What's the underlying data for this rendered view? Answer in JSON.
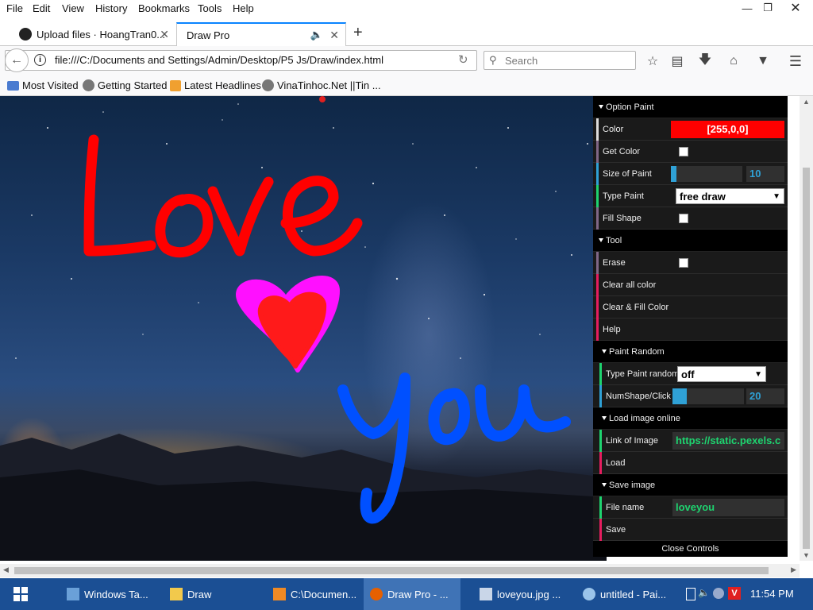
{
  "menubar": {
    "items": [
      "File",
      "Edit",
      "View",
      "History",
      "Bookmarks",
      "Tools",
      "Help"
    ],
    "window_controls": [
      "minimize",
      "maximize",
      "close"
    ]
  },
  "tabs": [
    {
      "label": "Upload files · HoangTran0...",
      "icon": "github-icon",
      "active": false
    },
    {
      "label": "Draw Pro",
      "icon": "audio-icon",
      "active": true
    }
  ],
  "new_tab_label": "+",
  "navbar": {
    "url": "file:///C:/Documents and Settings/Admin/Desktop/P5 Js/Draw/index.html",
    "search_placeholder": "Search"
  },
  "bookmarks": [
    {
      "label": "Most Visited",
      "icon": "bookmark-folder-icon"
    },
    {
      "label": "Getting Started",
      "icon": "globe-icon"
    },
    {
      "label": "Latest Headlines",
      "icon": "rss-icon"
    },
    {
      "label": "VinaTinhoc.Net ||Tin ...",
      "icon": "globe-icon"
    }
  ],
  "canvas": {
    "drawn_words": [
      "Love",
      "you"
    ],
    "stroke_color": "#ff0000",
    "heart_fill": "#ff10ff",
    "you_color": "#0050ff"
  },
  "gui": {
    "folders": {
      "option_paint": "Option Paint",
      "tool": "Tool",
      "paint_random": "Paint Random",
      "load_image": "Load image online",
      "save_image": "Save image"
    },
    "color_label": "Color",
    "color_value": "[255,0,0]",
    "color_swatch": "#ff0000",
    "get_color_label": "Get Color",
    "size_label": "Size of Paint",
    "size_value": "10",
    "size_fraction": 0.08,
    "type_paint_label": "Type Paint",
    "type_paint_value": "free draw",
    "fill_shape_label": "Fill Shape",
    "erase_label": "Erase",
    "clear_all_label": "Clear all color",
    "clear_fill_label": "Clear & Fill Color",
    "help_label": "Help",
    "type_random_label": "Type Paint random",
    "type_random_value": "off",
    "numshape_label": "NumShape/Click",
    "numshape_value": "20",
    "numshape_fraction": 0.2,
    "link_label": "Link of Image",
    "link_value": "https://static.pexels.c",
    "load_label": "Load",
    "filename_label": "File name",
    "filename_value": "loveyou",
    "save_label": "Save",
    "close_controls": "Close Controls"
  },
  "taskbar": {
    "items": [
      {
        "label": "Windows Ta...",
        "icon": "task-manager-icon"
      },
      {
        "label": "Draw",
        "icon": "folder-icon"
      },
      {
        "label": "C:\\Documen...",
        "icon": "sublime-icon"
      },
      {
        "label": "Draw Pro - ...",
        "icon": "firefox-icon"
      },
      {
        "label": "loveyou.jpg ...",
        "icon": "image-viewer-icon"
      },
      {
        "label": "untitled - Pai...",
        "icon": "paint-icon"
      }
    ],
    "clock": "11:54 PM"
  }
}
